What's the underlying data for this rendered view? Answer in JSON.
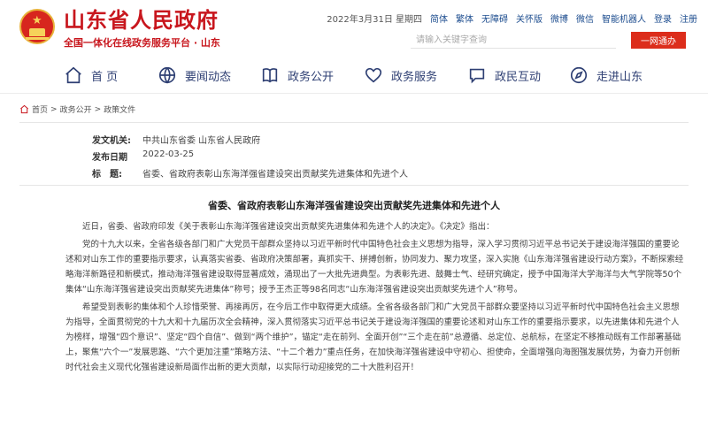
{
  "header": {
    "site_title": "山东省人民政府",
    "site_subtitle": "全国一体化在线政务服务平台 · 山东",
    "date": "2022年3月31日 星期四",
    "links": [
      "简体",
      "繁体",
      "无障碍",
      "关怀版",
      "微博",
      "微信",
      "智能机器人",
      "登录",
      "注册"
    ],
    "search_placeholder": "请输入关键字查询",
    "search_button": "一网通办"
  },
  "nav": {
    "items": [
      {
        "label": "首 页",
        "icon": "home-icon"
      },
      {
        "label": "要闻动态",
        "icon": "globe-icon"
      },
      {
        "label": "政务公开",
        "icon": "book-icon"
      },
      {
        "label": "政务服务",
        "icon": "heart-icon"
      },
      {
        "label": "政民互动",
        "icon": "chat-icon"
      },
      {
        "label": "走进山东",
        "icon": "compass-icon"
      }
    ]
  },
  "breadcrumb": {
    "home": "首页",
    "sep": ">",
    "section": "政务公开",
    "page": "政策文件"
  },
  "meta": {
    "issuer_label": "发文机关:",
    "issuer": "中共山东省委 山东省人民政府",
    "date_label": "发布日期",
    "date": "2022-03-25",
    "title_label": "标　题:",
    "title": "省委、省政府表彰山东海洋强省建设突出贡献奖先进集体和先进个人"
  },
  "article": {
    "title": "省委、省政府表彰山东海洋强省建设突出贡献奖先进集体和先进个人",
    "paragraphs": [
      "近日，省委、省政府印发《关于表彰山东海洋强省建设突出贡献奖先进集体和先进个人的决定》。《决定》指出：",
      "党的十九大以来，全省各级各部门和广大党员干部群众坚持以习近平新时代中国特色社会主义思想为指导，深入学习贯彻习近平总书记关于建设海洋强国的重要论述和对山东工作的重要指示要求，认真落实省委、省政府决策部署，真抓实干、拼搏创新，协同发力、聚力攻坚，深入实施《山东海洋强省建设行动方案》，不断探索经略海洋新路径和新模式，推动海洋强省建设取得显著成效，涌现出了一大批先进典型。为表彰先进、鼓舞士气、经研究确定，授予中国海洋大学海洋与大气学院等50个集体“山东海洋强省建设突出贡献奖先进集体”称号；授予王杰正等98名同志“山东海洋强省建设突出贡献奖先进个人”称号。",
      "希望受到表彰的集体和个人珍惜荣誉、再接再厉，在今后工作中取得更大成绩。全省各级各部门和广大党员干部群众要坚持以习近平新时代中国特色社会主义思想为指导，全面贯彻党的十九大和十九届历次全会精神，深入贯彻落实习近平总书记关于建设海洋强国的重要论述和对山东工作的重要指示要求，以先进集体和先进个人为榜样，增强“四个意识”、坚定“四个自信”、做到“两个维护”，锚定“走在前列、全面开创”“三个走在前”总遵循、总定位、总航标，在坚定不移推动既有工作部署基础上，聚焦“六个一”发展思路、“六个更加注重”策略方法、“十二个着力”重点任务，在加快海洋强省建设中守初心、担使命，全面增强向海图强发展优势，为奋力开创新时代社会主义现代化强省建设新局面作出新的更大贡献，以实际行动迎接党的二十大胜利召开！"
    ]
  },
  "colors": {
    "brand_red": "#c8161d",
    "button_red": "#dc2d1b",
    "nav_blue": "#2e3f73",
    "link_blue": "#1d4d8f"
  }
}
